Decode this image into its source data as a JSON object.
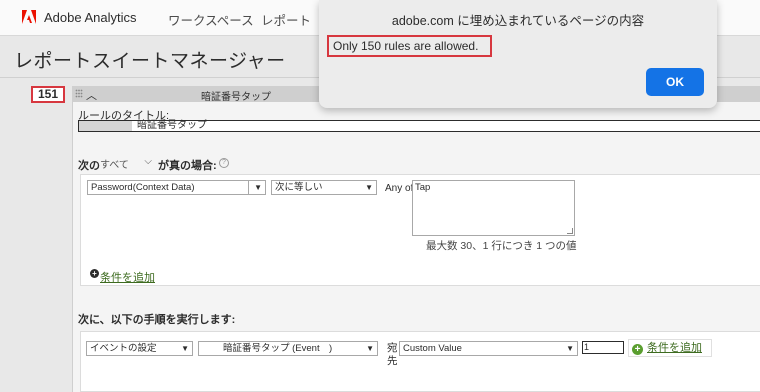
{
  "topbar": {
    "brand": "Adobe Analytics",
    "nav": [
      "ワークスペース",
      "レポート"
    ],
    "brand_color": "#eb1000"
  },
  "page": {
    "title": "レポートスイートマネージャー"
  },
  "rule": {
    "number": "151",
    "header_title": "暗証番号タップ",
    "title_label": "ルールのタイトル:",
    "title_value": "暗証番号タップ",
    "condition": {
      "prefix": "次の",
      "match_select": "すべて",
      "suffix": "が真の場合:",
      "help": "?",
      "variable": "Password(Context Data)",
      "operator": "次に等しい",
      "any_of_label": "Any of",
      "values": "Tap",
      "hint": "最大数 30、1 行につき 1 つの値",
      "add_label": "条件を追加",
      "plus": "+"
    },
    "action": {
      "label": "次に、以下の手順を実行します:",
      "type": "イベントの設定",
      "event": "暗証番号タップ (Event",
      "event_close": ")",
      "dest_label": "宛先",
      "value_type": "Custom Value",
      "value": "1",
      "add_label": "条件を追加",
      "plus": "+"
    }
  },
  "dialog": {
    "title": "adobe.com に埋め込まれているページの内容",
    "message": "Only 150 rules are allowed.",
    "ok_label": "OK",
    "ok_color": "#1473e6"
  }
}
